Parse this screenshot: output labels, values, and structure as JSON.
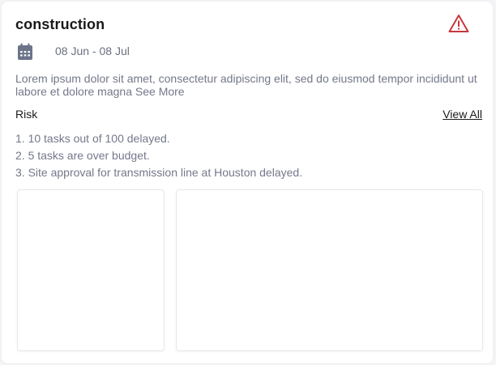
{
  "project": {
    "title": "construction",
    "date_range": "08 Jun - 08 Jul",
    "description": "Lorem ipsum dolor sit amet, consectetur adipiscing elit, sed do eiusmod tempor incididunt ut labore et dolore magna",
    "see_more_label": "See More",
    "alert_icon": "warning-triangle-icon",
    "alert_color": "#c8373b"
  },
  "risk": {
    "label": "Risk",
    "view_all_label": "View All",
    "items": [
      "1. 10 tasks out of 100 delayed.",
      "2. 5 tasks are over budget.",
      "3. Site approval for transmission line at Houston delayed."
    ]
  }
}
